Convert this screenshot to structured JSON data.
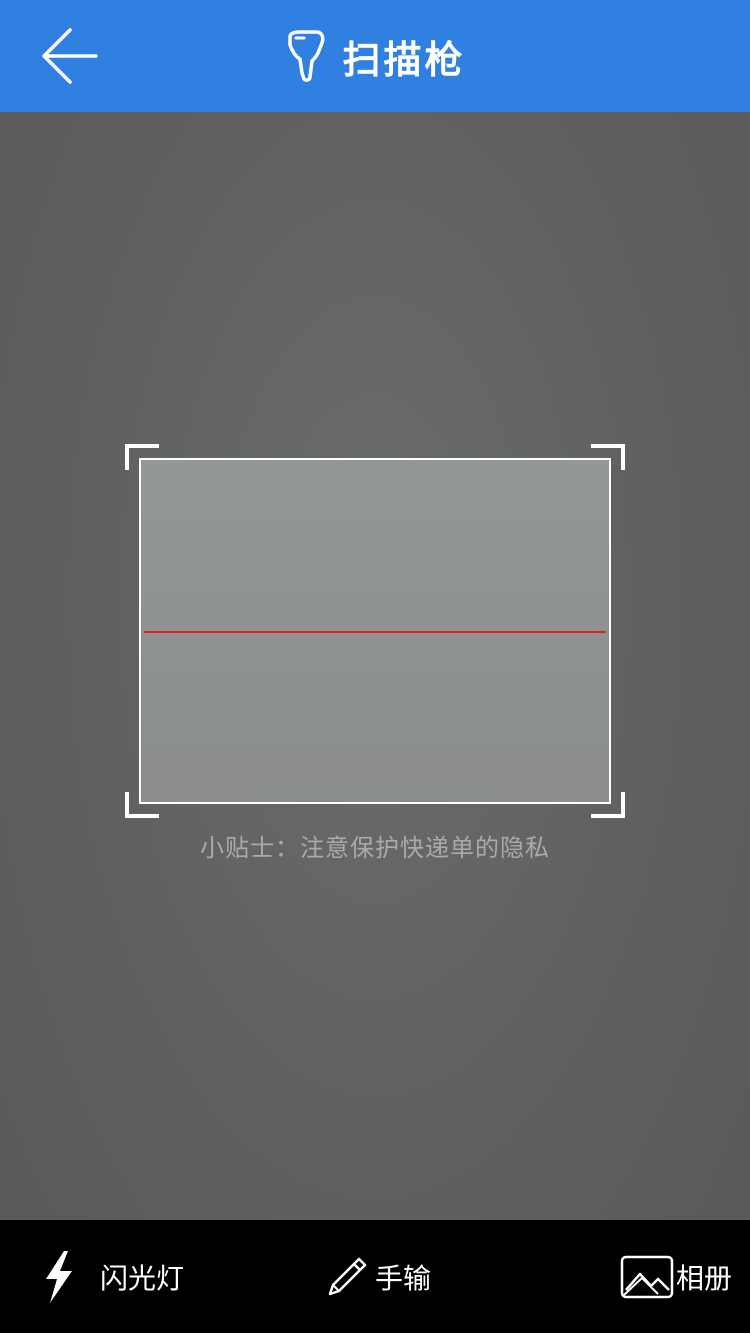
{
  "header": {
    "title": "扫描枪",
    "back_icon": "arrow-left-icon",
    "title_icon": "scanner-gun-icon",
    "background_color": "#2f80e0"
  },
  "scanner": {
    "tip": "小贴士：注意保护快递单的隐私",
    "scan_line_color": "#e02020"
  },
  "toolbar": {
    "flash_label": "闪光灯",
    "flash_icon": "lightning-icon",
    "manual_label": "手输",
    "manual_icon": "pencil-icon",
    "album_label": "相册",
    "album_icon": "image-icon"
  }
}
